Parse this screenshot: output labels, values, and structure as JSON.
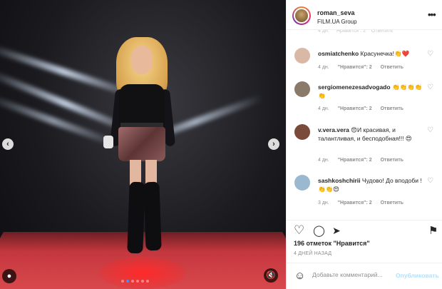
{
  "header": {
    "username": "roman_seva",
    "subtitle": "FILM.UA Group",
    "more_icon": "more-dots-icon"
  },
  "media": {
    "prev_icon": "‹",
    "next_icon": "›",
    "dots_total": 6,
    "active_dot": 1
  },
  "comments": [
    {
      "username": "osmiatchenko",
      "text": "Красунечка!👏❤️",
      "time": "4 дн.",
      "likes": "\"Нравится\": 2",
      "reply": "Ответить",
      "avatar_color": "#d9b8a5"
    },
    {
      "username": "sergiomenezesadvogado",
      "text": "👏👏👏👏👏",
      "time": "4 дн.",
      "likes": "\"Нравится\": 2",
      "reply": "Ответить",
      "avatar_color": "#8a7a6a"
    },
    {
      "username": "v.vera.vera",
      "text": "😍И красивая, и талантливая, и бесподобная!!! 😍",
      "time": "4 дн.",
      "likes": "\"Нравится\": 2",
      "reply": "Ответить",
      "avatar_color": "#7a4a3a"
    },
    {
      "username": "sashkoshchirii",
      "text": "Чудово! До вподоби !👏👏😍",
      "time": "3 дн.",
      "likes": "\"Нравится\": 2",
      "reply": "Ответить",
      "avatar_color": "#9ab8d0"
    }
  ],
  "actions": {
    "like_icon": "♡",
    "comment_icon": "◯",
    "share_icon": "➤",
    "save_icon": "⚑",
    "likes_text": "196 отметок \"Нравится\"",
    "time_ago": "4 ДНЕЙ НАЗАД"
  },
  "add_comment": {
    "emoji_icon": "☺",
    "placeholder": "Добавьте комментарий...",
    "post_label": "Опубликовать"
  },
  "colors": {
    "accent": "#3897f0",
    "post_disabled": "#b2dffc"
  }
}
